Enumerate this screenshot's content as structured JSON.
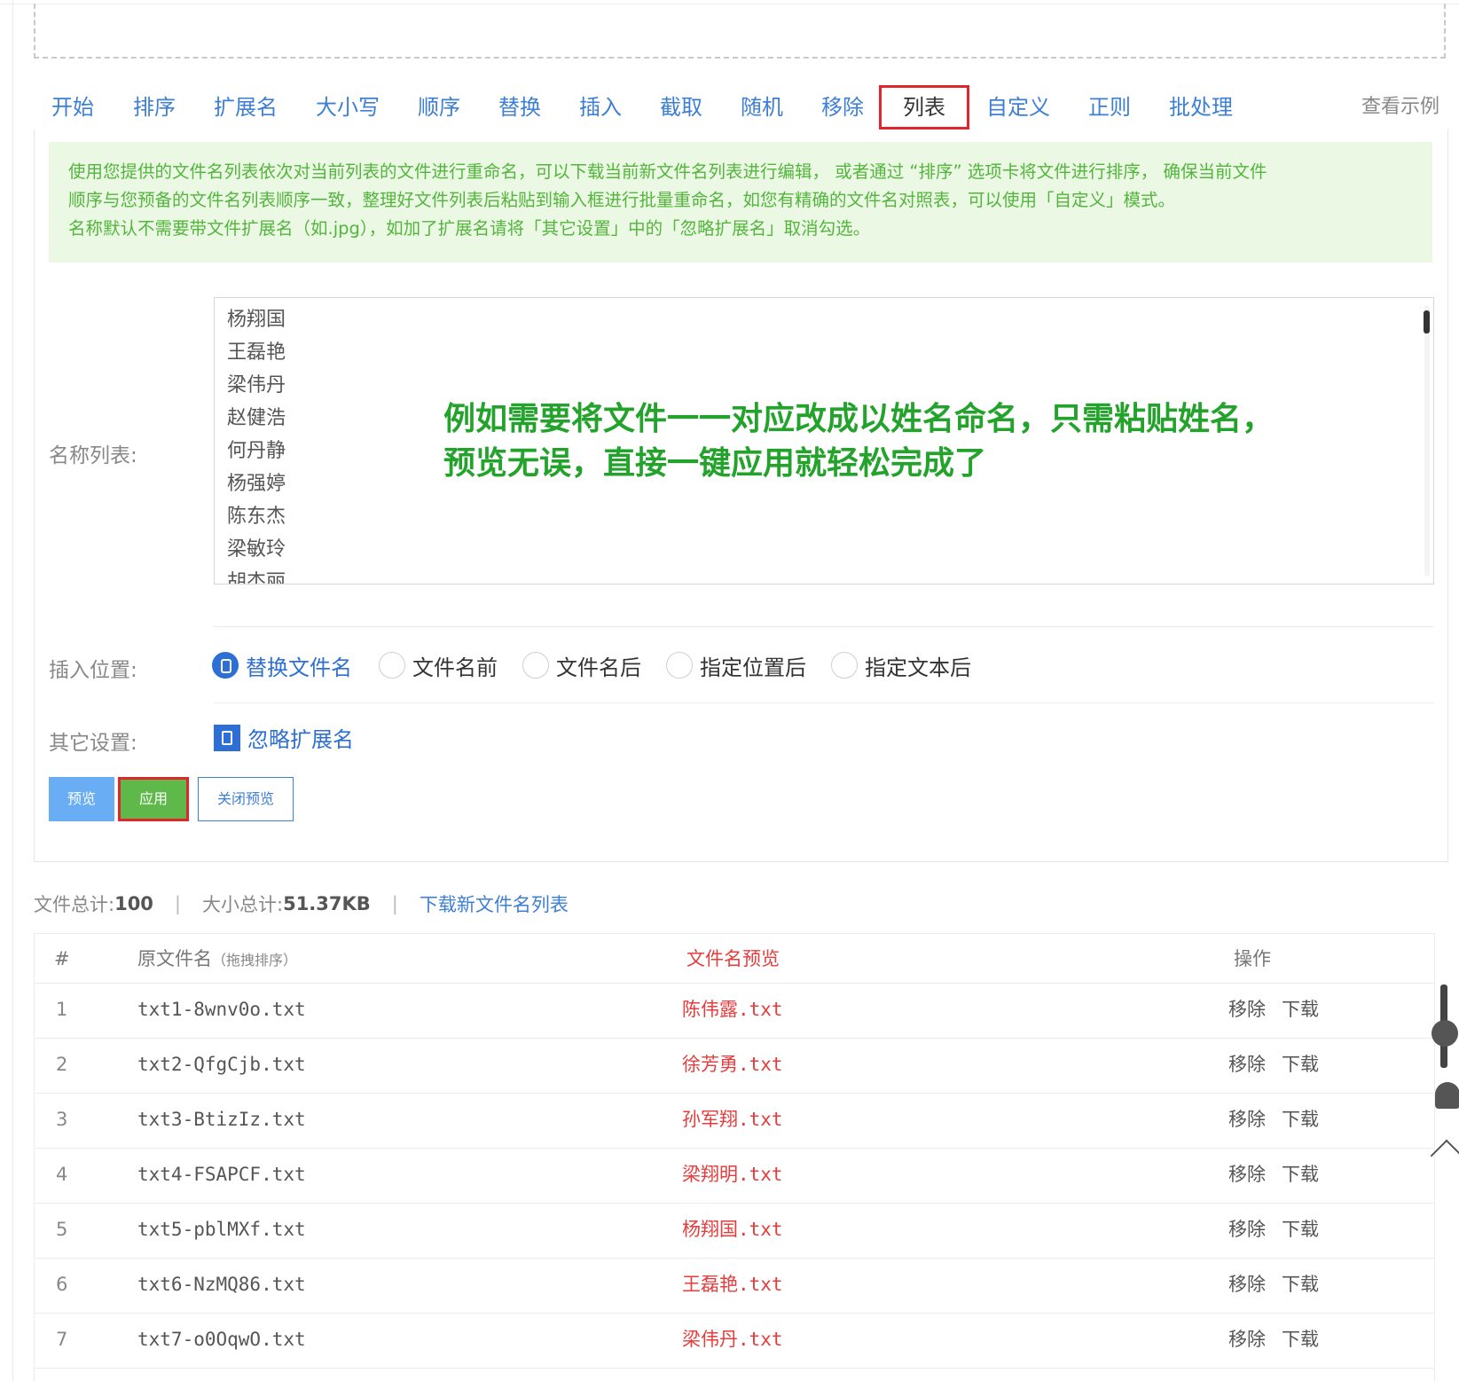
{
  "tabs": [
    {
      "label": "开始"
    },
    {
      "label": "排序"
    },
    {
      "label": "扩展名"
    },
    {
      "label": "大小写"
    },
    {
      "label": "顺序"
    },
    {
      "label": "替换"
    },
    {
      "label": "插入"
    },
    {
      "label": "截取"
    },
    {
      "label": "随机"
    },
    {
      "label": "移除"
    },
    {
      "label": "列表"
    },
    {
      "label": "自定义"
    },
    {
      "label": "正则"
    },
    {
      "label": "批处理"
    }
  ],
  "view_example": "查看示例",
  "tip": {
    "line1": "使用您提供的文件名列表依次对当前列表的文件进行重命名，可以下载当前新文件名列表进行编辑， 或者通过 “排序” 选项卡将文件进行排序， 确保当前文件",
    "line2": "顺序与您预备的文件名列表顺序一致，整理好文件列表后粘贴到输入框进行批量重命名，如您有精确的文件名对照表，可以使用「自定义」模式。",
    "line3": "名称默认不需要带文件扩展名（如.jpg），如加了扩展名请将「其它设置」中的「忽略扩展名」取消勾选。"
  },
  "labels": {
    "names_list": "名称列表:",
    "insert_position": "插入位置:",
    "other_settings": "其它设置:"
  },
  "names": [
    "杨翔国",
    "王磊艳",
    "梁伟丹",
    "赵健浩",
    "何丹静",
    "杨强婷",
    "陈东杰",
    "梁敏玲",
    "胡杰丽"
  ],
  "overlay": {
    "line1": "例如需要将文件一一对应改成以姓名命名，只需粘贴姓名，",
    "line2": "预览无误，直接一键应用就轻松完成了"
  },
  "insert_options": [
    {
      "label": "替换文件名",
      "selected": true
    },
    {
      "label": "文件名前",
      "selected": false
    },
    {
      "label": "文件名后",
      "selected": false
    },
    {
      "label": "指定位置后",
      "selected": false
    },
    {
      "label": "指定文本后",
      "selected": false
    }
  ],
  "ignore_ext": {
    "label": "忽略扩展名",
    "checked": true
  },
  "buttons": {
    "preview": "预览",
    "apply": "应用",
    "close_preview": "关闭预览"
  },
  "summary": {
    "file_total_label": "文件总计:",
    "file_total": "100",
    "size_total_label": "大小总计:",
    "size_total": "51.37KB",
    "download_link": "下载新文件名列表",
    "pipe": "|"
  },
  "table": {
    "headers": {
      "idx": "#",
      "orig": "原文件名",
      "orig_hint": "（拖拽排序）",
      "preview": "文件名预览",
      "ops": "操作"
    },
    "rows": [
      {
        "idx": "1",
        "orig": "txt1-8wnv0o.txt",
        "new": "陈伟露.txt",
        "remove": "移除",
        "download": "下载"
      },
      {
        "idx": "2",
        "orig": "txt2-QfgCjb.txt",
        "new": "徐芳勇.txt",
        "remove": "移除",
        "download": "下载"
      },
      {
        "idx": "3",
        "orig": "txt3-BtizIz.txt",
        "new": "孙军翔.txt",
        "remove": "移除",
        "download": "下载"
      },
      {
        "idx": "4",
        "orig": "txt4-FSAPCF.txt",
        "new": "梁翔明.txt",
        "remove": "移除",
        "download": "下载"
      },
      {
        "idx": "5",
        "orig": "txt5-pblMXf.txt",
        "new": "杨翔国.txt",
        "remove": "移除",
        "download": "下载"
      },
      {
        "idx": "6",
        "orig": "txt6-NzMQ86.txt",
        "new": "王磊艳.txt",
        "remove": "移除",
        "download": "下载"
      },
      {
        "idx": "7",
        "orig": "txt7-o0OqwO.txt",
        "new": "梁伟丹.txt",
        "remove": "移除",
        "download": "下载"
      }
    ]
  },
  "colors": {
    "accent_blue": "#3d7fd6",
    "highlight_red": "#e0262b",
    "tip_green": "#54b53d",
    "overlay_green": "#23a32b"
  }
}
